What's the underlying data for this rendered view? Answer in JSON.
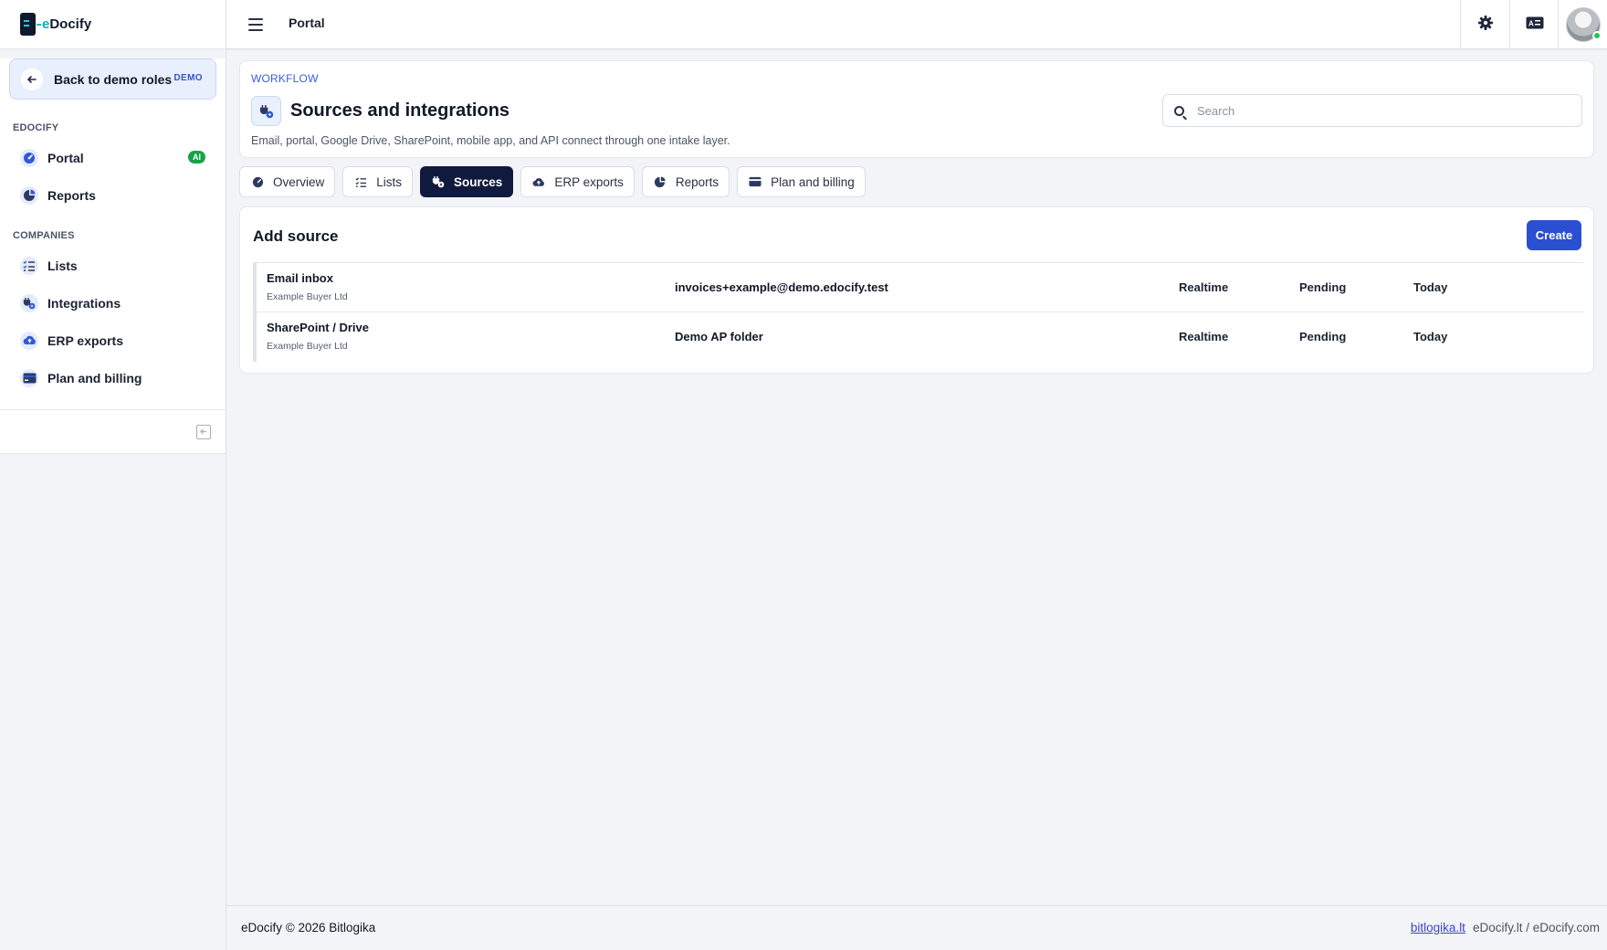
{
  "app": {
    "logo_prefix": "e",
    "logo_name": "Docify"
  },
  "sidebar": {
    "back_label": "Back to demo roles",
    "back_badge": "DEMO",
    "sections": [
      {
        "title": "EDOCIFY"
      },
      {
        "title": "COMPANIES"
      }
    ],
    "items": [
      {
        "label": "Portal",
        "badge": "AI",
        "icon": "gauge-icon"
      },
      {
        "label": "Reports",
        "icon": "pie-chart-icon"
      },
      {
        "label": "Lists",
        "icon": "list-icon"
      },
      {
        "label": "Integrations",
        "icon": "plug-icon"
      },
      {
        "label": "ERP exports",
        "icon": "cloud-upload-icon"
      },
      {
        "label": "Plan and billing",
        "icon": "credit-card-icon"
      }
    ]
  },
  "topbar": {
    "title": "Portal",
    "icons": [
      "gear-icon",
      "id-card-icon",
      "avatar"
    ]
  },
  "header": {
    "eyebrow": "WORKFLOW",
    "title": "Sources and integrations",
    "subtitle": "Email, portal, Google Drive, SharePoint, mobile app, and API connect through one intake layer.",
    "search_placeholder": "Search"
  },
  "tabs": [
    {
      "label": "Overview",
      "icon": "gauge-icon"
    },
    {
      "label": "Lists",
      "icon": "list-icon"
    },
    {
      "label": "Sources",
      "icon": "plug-icon",
      "active": true
    },
    {
      "label": "ERP exports",
      "icon": "cloud-upload-icon"
    },
    {
      "label": "Reports",
      "icon": "pie-chart-icon"
    },
    {
      "label": "Plan and billing",
      "icon": "credit-card-icon"
    }
  ],
  "sources": {
    "title": "Add source",
    "create_label": "Create",
    "rows": [
      {
        "name": "Email inbox",
        "company": "Example Buyer Ltd",
        "target": "invoices+example@demo.edocify.test",
        "mode": "Realtime",
        "status": "Pending",
        "when": "Today"
      },
      {
        "name": "SharePoint / Drive",
        "company": "Example Buyer Ltd",
        "target": "Demo AP folder",
        "mode": "Realtime",
        "status": "Pending",
        "when": "Today"
      }
    ]
  },
  "footer": {
    "brand": "eDocify",
    "copyright": "© 2026 Bitlogika",
    "link": "bitlogika.lt",
    "domains": "eDocify.lt / eDocify.com"
  },
  "colors": {
    "accent": "#2b4fd1",
    "active_tab": "#101a3f",
    "ai_badge": "#16a34a",
    "online": "#22c55e"
  }
}
